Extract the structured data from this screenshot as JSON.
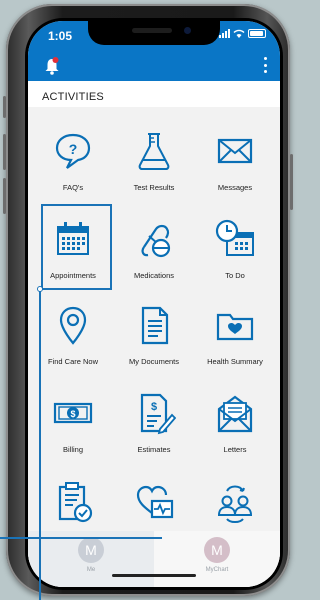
{
  "status_bar": {
    "time": "1:05"
  },
  "header": {
    "bell": "bell-icon",
    "menu": "kebab-menu-icon",
    "color": "#0a76c6"
  },
  "section": {
    "title": "ACTIVITIES"
  },
  "activities": [
    {
      "label": "FAQ's",
      "icon": "faq-speech-icon"
    },
    {
      "label": "Test Results",
      "icon": "flask-icon"
    },
    {
      "label": "Messages",
      "icon": "envelope-icon"
    },
    {
      "label": "Appointments",
      "icon": "calendar-icon"
    },
    {
      "label": "Medications",
      "icon": "pill-icon"
    },
    {
      "label": "To Do",
      "icon": "clock-calendar-icon"
    },
    {
      "label": "Find Care Now",
      "icon": "location-pin-icon"
    },
    {
      "label": "My Documents",
      "icon": "document-icon"
    },
    {
      "label": "Health Summary",
      "icon": "heart-folder-icon"
    },
    {
      "label": "Billing",
      "icon": "dollar-bill-icon"
    },
    {
      "label": "Estimates",
      "icon": "estimate-icon"
    },
    {
      "label": "Letters",
      "icon": "open-letter-icon"
    },
    {
      "label": "",
      "icon": "clipboard-check-icon"
    },
    {
      "label": "",
      "icon": "heart-monitor-icon"
    },
    {
      "label": "",
      "icon": "share-people-icon"
    }
  ],
  "tabbar": {
    "me": {
      "initial": "M",
      "label": "Me"
    },
    "mychart": {
      "initial": "M",
      "label": "MyChart"
    }
  },
  "colors": {
    "accent": "#1a73b7",
    "header": "#0a76c6"
  }
}
